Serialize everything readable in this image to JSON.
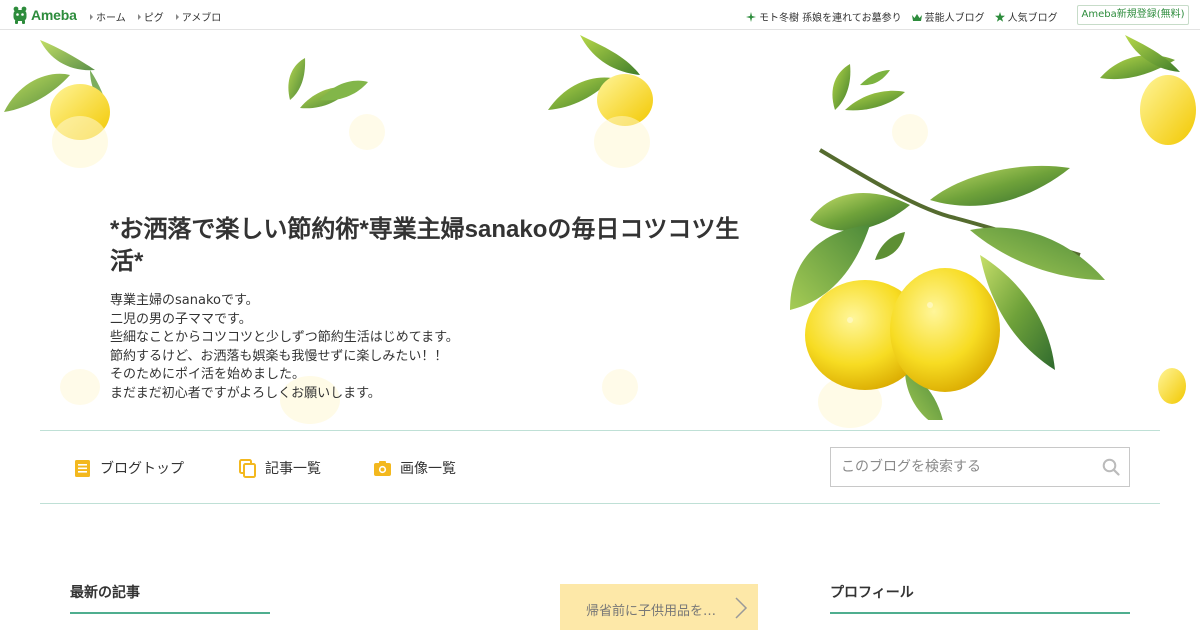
{
  "topbar": {
    "logo_text": "Ameba",
    "nav": [
      {
        "label": "ホーム"
      },
      {
        "label": "ピグ"
      },
      {
        "label": "アメブロ"
      }
    ],
    "links": [
      {
        "label": "モト冬樹 孫娘を連れてお墓参り",
        "icon": "sparkle-icon"
      },
      {
        "label": "芸能人ブログ",
        "icon": "crown-icon"
      },
      {
        "label": "人気ブログ",
        "icon": "star-icon"
      }
    ],
    "signup_label": "Ameba新規登録(無料)"
  },
  "header": {
    "title": "*お洒落で楽しい節約術*専業主婦sanakoの毎日コツコツ生活*",
    "description": [
      "専業主婦のsanakoです。",
      "二児の男の子ママです。",
      "些細なことからコツコツと少しずつ節約生活はじめてます。",
      "節約するけど、お洒落も娯楽も我慢せずに楽しみたい！！",
      "そのためにポイ活を始めました。",
      "まだまだ初心者ですがよろしくお願いします。"
    ]
  },
  "blognav": {
    "items": [
      {
        "label": "ブログトップ",
        "icon": "document-icon"
      },
      {
        "label": "記事一覧",
        "icon": "copy-icon"
      },
      {
        "label": "画像一覧",
        "icon": "camera-icon"
      }
    ],
    "search_placeholder": "このブログを検索する"
  },
  "content": {
    "latest_title": "最新の記事",
    "banner_text": "帰省前に子供用品を…",
    "profile_title": "プロフィール"
  },
  "colors": {
    "brand_green": "#2d8c3c",
    "nav_icon_yellow": "#f3b81e",
    "accent_rule": "#4fae8f",
    "banner_bg": "#fde8a8"
  }
}
